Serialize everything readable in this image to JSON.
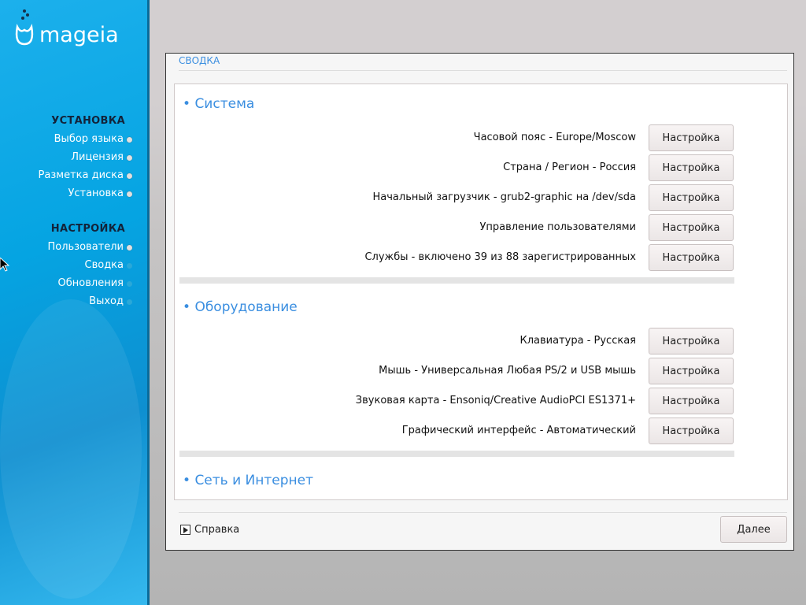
{
  "brand": "mageia",
  "sidebar": {
    "sections": [
      {
        "title": "УСТАНОВКА",
        "items": [
          {
            "label": "Выбор языка",
            "state": "done"
          },
          {
            "label": "Лицензия",
            "state": "done"
          },
          {
            "label": "Разметка диска",
            "state": "done"
          },
          {
            "label": "Установка",
            "state": "done"
          }
        ]
      },
      {
        "title": "НАСТРОЙКА",
        "items": [
          {
            "label": "Пользователи",
            "state": "done"
          },
          {
            "label": "Сводка",
            "state": "pending"
          },
          {
            "label": "Обновления",
            "state": "pending"
          },
          {
            "label": "Выход",
            "state": "pending"
          }
        ]
      }
    ]
  },
  "window": {
    "title": "СВОДКА",
    "help_label": "Справка",
    "next_label": "Далее"
  },
  "groups": [
    {
      "title": "Система",
      "rows": [
        {
          "label": "Часовой пояс - Europe/Moscow",
          "button": "Настройка"
        },
        {
          "label": "Страна / Регион - Россия",
          "button": "Настройка"
        },
        {
          "label": "Начальный загрузчик - grub2-graphic на /dev/sda",
          "button": "Настройка"
        },
        {
          "label": "Управление пользователями",
          "button": "Настройка"
        },
        {
          "label": "Службы - включено 39 из 88 зарегистрированных",
          "button": "Настройка"
        }
      ]
    },
    {
      "title": "Оборудование",
      "rows": [
        {
          "label": "Клавиатура - Русская",
          "button": "Настройка"
        },
        {
          "label": "Мышь - Универсальная Любая PS/2 и USB мышь",
          "button": "Настройка"
        },
        {
          "label": "Звуковая карта - Ensoniq/Creative AudioPCI ES1371+",
          "button": "Настройка"
        },
        {
          "label": "Графический интерфейс - Автоматический",
          "button": "Настройка"
        }
      ]
    },
    {
      "title": "Сеть и Интернет",
      "rows": []
    }
  ]
}
